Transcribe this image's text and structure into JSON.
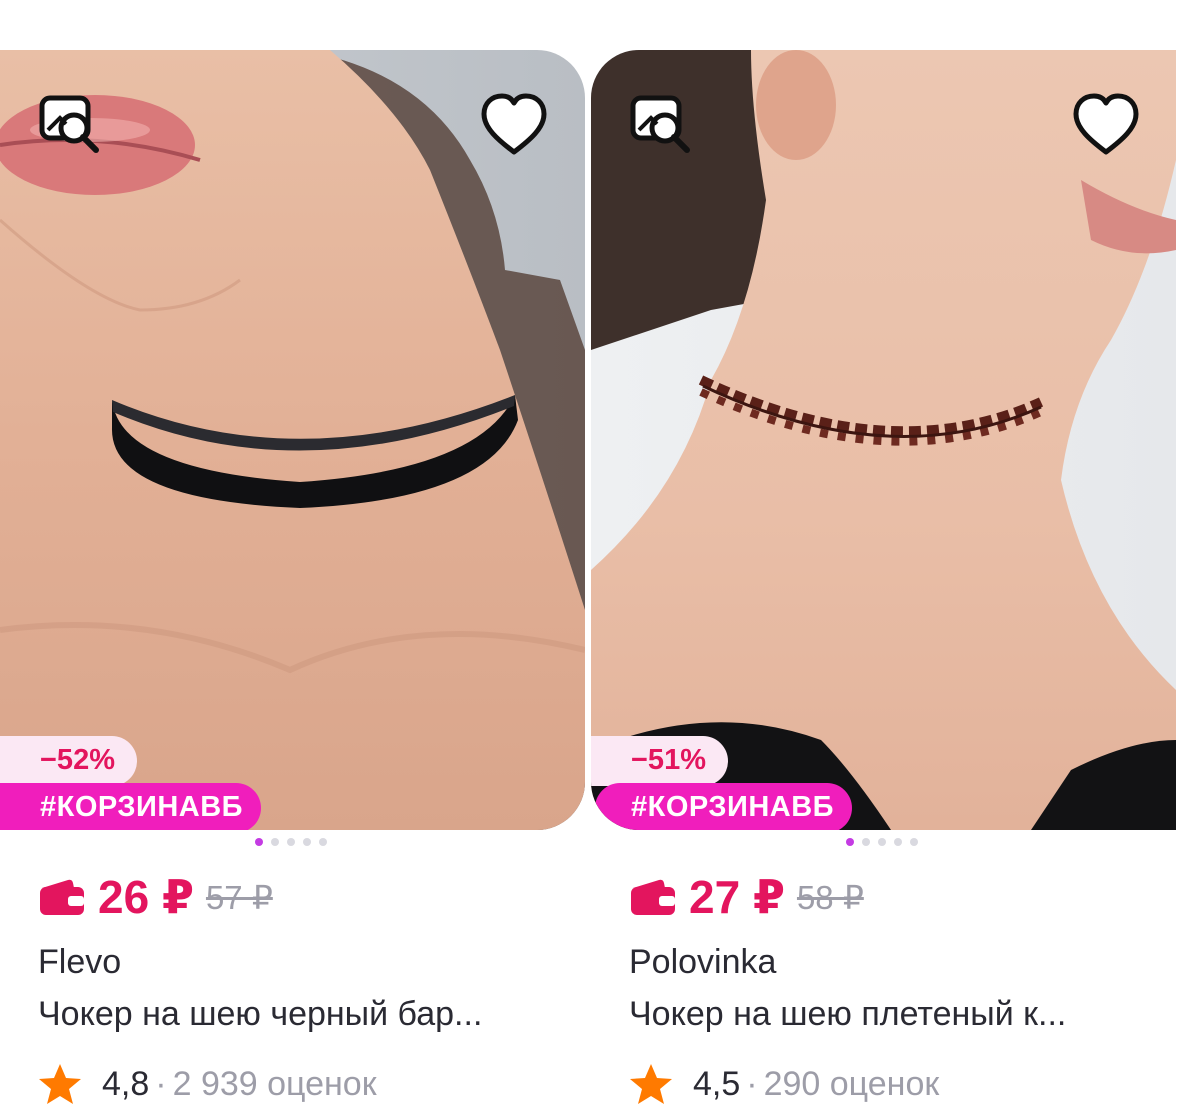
{
  "products": [
    {
      "discount": "−52%",
      "promo": "#КОРЗИНАВБ",
      "price": "26 ₽",
      "old_price": "57 ₽",
      "brand": "Flevo",
      "title": "Чокер на шею черный бар...",
      "rating": "4,8",
      "separator": "·",
      "reviews": "2 939 оценок",
      "carousel_active_index": 1,
      "carousel_count": 5
    },
    {
      "discount": "−51%",
      "promo": "#КОРЗИНАВБ",
      "price": "27 ₽",
      "old_price": "58 ₽",
      "brand": "Polovinka",
      "title": "Чокер на шею плетеный к...",
      "rating": "4,5",
      "separator": "·",
      "reviews": "290 оценок",
      "carousel_active_index": 1,
      "carousel_count": 5
    }
  ],
  "icons": {
    "visual_search": "visual-search-icon",
    "favorite": "heart-icon",
    "wallet": "wallet-icon",
    "star": "star-icon"
  },
  "colors": {
    "price": "#e3155e",
    "promo_bg": "#f01ebc",
    "discount_bg": "#fbe8f4",
    "star": "#ff7a00",
    "muted": "#9d9da8"
  }
}
